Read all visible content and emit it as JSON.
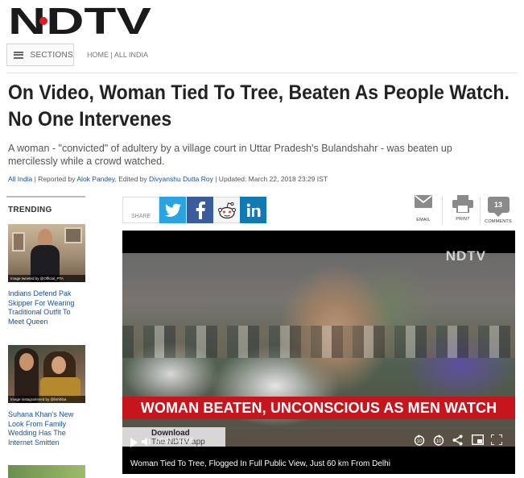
{
  "brand": {
    "logo_text": "NDTV",
    "accent": "#e01b22",
    "link_color": "#1a4f9c"
  },
  "nav": {
    "sections_label": "SECTIONS",
    "breadcrumb": "HOME | ALL INDIA"
  },
  "article": {
    "headline": "On Video, Woman Tied To Tree, Beaten As People Watch. No One Intervenes",
    "summary": "A woman - \"convicted\" of adultery by a village court in Uttar Pradesh's Bulandshahr - was beaten up mercilessly while a crowd watched.",
    "byline": {
      "category": "All India",
      "reported_prefix": " | Reported by ",
      "reporter": "Alok Pandey",
      "edited_prefix": ", Edited by ",
      "editor": "Divyanshu Dutta Roy",
      "updated": " | Updated: March 22, 2018 23:29 IST"
    }
  },
  "share": {
    "label": "SHARE",
    "networks": [
      "twitter",
      "facebook",
      "reddit",
      "linkedin"
    ],
    "actions": {
      "email": "EMAIL",
      "print": "PRINT",
      "comments": "COMMENTS",
      "comment_count": "13"
    }
  },
  "trending": {
    "title": "TRENDING",
    "items": [
      {
        "caption": "Indians Defend Pak Skipper For Wearing Traditional Outfit To Meet Queen",
        "credit": "Image tweeted by @Official_PTA"
      },
      {
        "caption": "Suhana Khan's New Look From Family Wedding Has The Internet Smitten",
        "credit": "Image instagrammed by @lishhiba"
      }
    ]
  },
  "video": {
    "watermark": "NDTV",
    "banner": "WOMAN BEATEN, UNCONSCIOUS AS MEN WATCH",
    "download_label": "Download",
    "download_sub": "The NDTV app",
    "time": "00:02 / 03:06",
    "progress": 0.005,
    "caption": "Woman Tied To Tree, Flogged In Full Public View, Just 60 km From Delhi"
  }
}
